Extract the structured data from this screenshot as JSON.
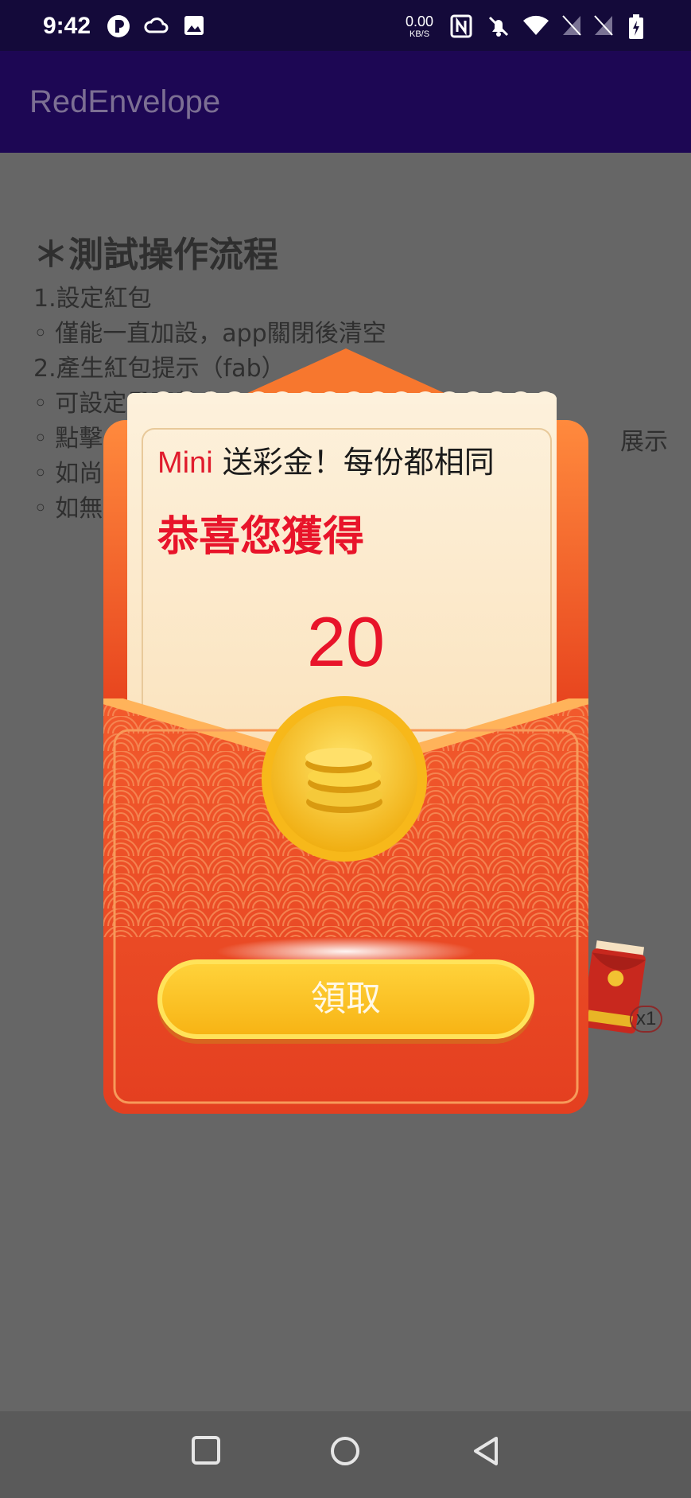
{
  "status_bar": {
    "time": "9:42",
    "speed_value": "0.00",
    "speed_unit": "KB/S"
  },
  "app_bar": {
    "title": "RedEnvelope"
  },
  "content": {
    "heading": "＊測試操作流程",
    "lines": [
      "1.設定紅包",
      "◦ 僅能一直加設，app關閉後清空",
      "2.產生紅包提示（fab）",
      "◦ 可設定是否數字",
      "◦ 點擊",
      "◦ 如尚",
      "◦ 如無"
    ],
    "partial_right": "展示"
  },
  "fab": {
    "badge": "x1"
  },
  "dialog": {
    "sender_name": "Mini",
    "sender_text": " 送彩金！每份都相同",
    "congrats": "恭喜您獲得",
    "amount": "20",
    "claim_label": "領取"
  },
  "colors": {
    "envelope_red": "#e8461f",
    "letter_cream": "#fbe6c4",
    "accent_red": "#e8142a",
    "button_gold": "#ffd23a",
    "app_bar": "#1d0754"
  },
  "nav": [
    "recent-apps-icon",
    "home-icon",
    "back-icon"
  ]
}
